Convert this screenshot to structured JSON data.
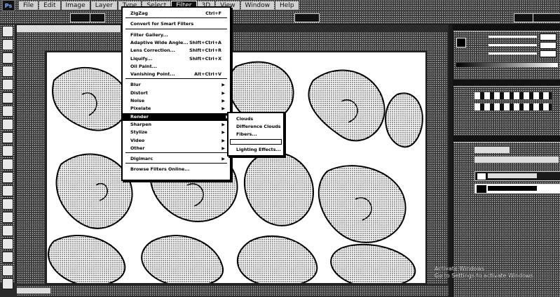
{
  "menubar": {
    "items": [
      "File",
      "Edit",
      "Image",
      "Layer",
      "Type",
      "Select",
      "Filter",
      "3D",
      "View",
      "Window",
      "Help"
    ],
    "active_index": 6
  },
  "filter_menu": {
    "items": [
      {
        "label": "ZigZag",
        "shortcut": "Ctrl+F"
      },
      {
        "label": "Convert for Smart Filters",
        "shortcut": ""
      },
      {
        "label": "Filter Gallery...",
        "shortcut": ""
      },
      {
        "label": "Adaptive Wide Angle...",
        "shortcut": "Shift+Ctrl+A"
      },
      {
        "label": "Lens Correction...",
        "shortcut": "Shift+Ctrl+R"
      },
      {
        "label": "Liquify...",
        "shortcut": "Shift+Ctrl+X"
      },
      {
        "label": "Oil Paint...",
        "shortcut": ""
      },
      {
        "label": "Vanishing Point...",
        "shortcut": "Alt+Ctrl+V"
      },
      {
        "label": "Blur",
        "submenu": true
      },
      {
        "label": "Distort",
        "submenu": true
      },
      {
        "label": "Noise",
        "submenu": true
      },
      {
        "label": "Pixelate",
        "submenu": true
      },
      {
        "label": "Render",
        "submenu": true
      },
      {
        "label": "Sharpen",
        "submenu": true
      },
      {
        "label": "Stylize",
        "submenu": true
      },
      {
        "label": "Video",
        "submenu": true
      },
      {
        "label": "Other",
        "submenu": true
      },
      {
        "label": "Digimarc",
        "submenu": true
      },
      {
        "label": "Browse Filters Online...",
        "shortcut": ""
      }
    ],
    "highlighted_index": 12
  },
  "render_submenu": {
    "items": [
      "Clouds",
      "Difference Clouds",
      "Fibers...",
      "",
      "Lighting Effects..."
    ]
  },
  "watermark": {
    "line1": "Activate Windows",
    "line2": "Go to Settings to activate Windows."
  },
  "colors": {
    "menu_bg": "#ffffff",
    "menu_highlight": "#000000",
    "app_bg": "#2b2b2b"
  }
}
